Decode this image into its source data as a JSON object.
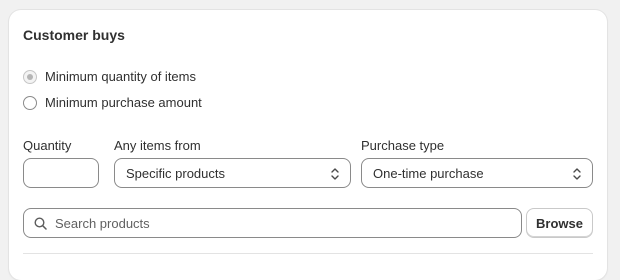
{
  "section": {
    "title": "Customer buys"
  },
  "requirement": {
    "options": [
      {
        "label": "Minimum quantity of items",
        "selected": true
      },
      {
        "label": "Minimum purchase amount",
        "selected": false
      }
    ]
  },
  "fields": {
    "quantity_label": "Quantity",
    "quantity_value": "",
    "items_from_label": "Any items from",
    "items_from_value": "Specific products",
    "purchase_type_label": "Purchase type",
    "purchase_type_value": "One-time purchase"
  },
  "search": {
    "placeholder": "Search products",
    "browse_label": "Browse"
  },
  "icons": {
    "search": "search-icon",
    "select_chevron": "chevron-up-down-icon"
  }
}
